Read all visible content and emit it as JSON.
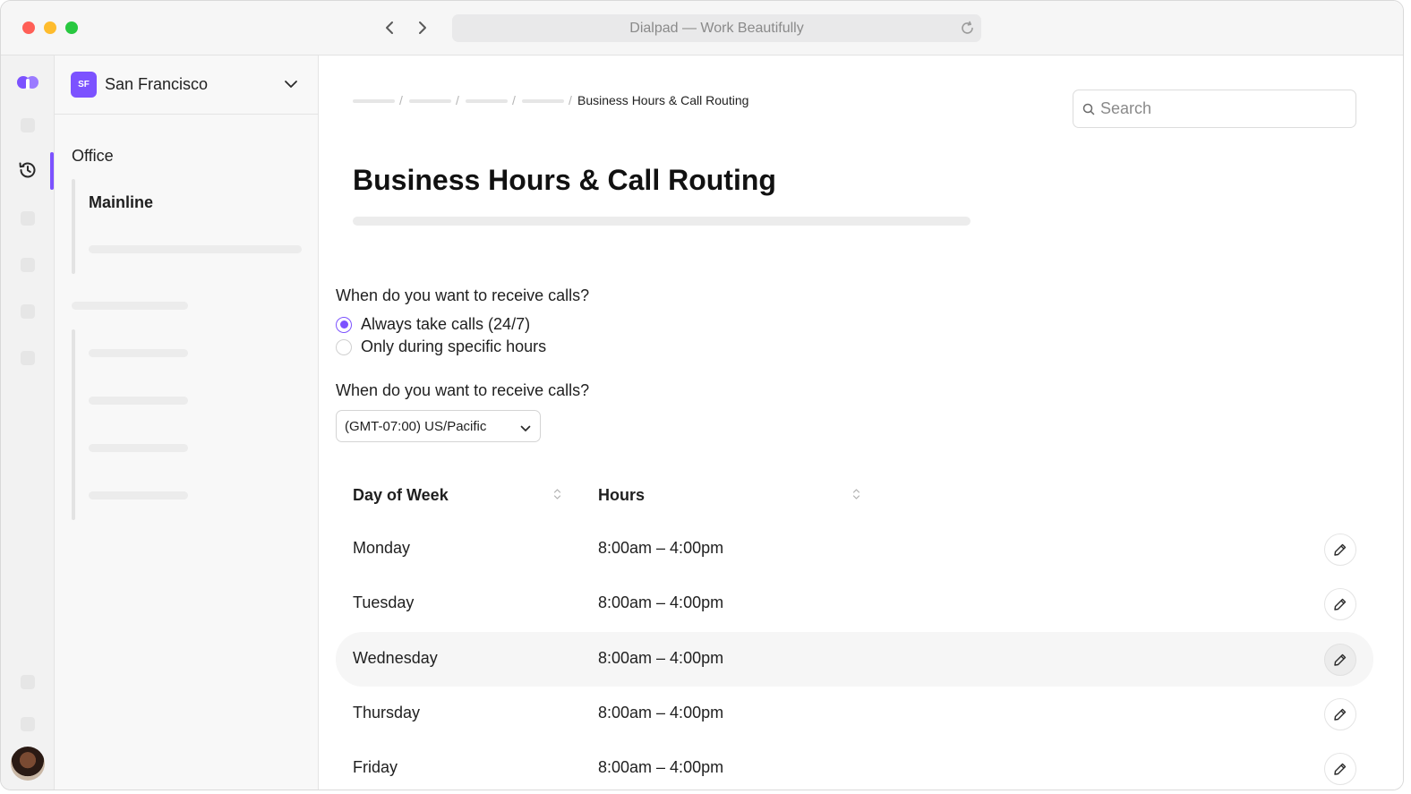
{
  "browser": {
    "url_title": "Dialpad — Work Beautifully"
  },
  "sidebar": {
    "org_badge": "SF",
    "org_name": "San Francisco",
    "section": "Office",
    "active_item": "Mainline"
  },
  "breadcrumb": {
    "current": "Business Hours & Call Routing",
    "separator": "/"
  },
  "search": {
    "placeholder": "Search"
  },
  "page": {
    "title": "Business Hours & Call Routing"
  },
  "calls_question": {
    "label": "When do you want to receive calls?",
    "options": [
      {
        "label": "Always take calls (24/7)",
        "checked": true
      },
      {
        "label": "Only during specific hours",
        "checked": false
      }
    ]
  },
  "timezone_question": {
    "label": "When do you want to receive calls?",
    "selected": "(GMT-07:00) US/Pacific"
  },
  "table": {
    "headers": [
      "Day of Week",
      "Hours"
    ],
    "rows": [
      {
        "day": "Monday",
        "hours": "8:00am – 4:00pm"
      },
      {
        "day": "Tuesday",
        "hours": "8:00am – 4:00pm"
      },
      {
        "day": "Wednesday",
        "hours": "8:00am – 4:00pm"
      },
      {
        "day": "Thursday",
        "hours": "8:00am – 4:00pm"
      },
      {
        "day": "Friday",
        "hours": "8:00am – 4:00pm"
      }
    ]
  },
  "colors": {
    "accent": "#7c52ff",
    "traffic_red": "#ff5f57",
    "traffic_yellow": "#febc2e",
    "traffic_green": "#28c840"
  },
  "icons": {
    "back": "chevron-left-icon",
    "forward": "chevron-right-icon",
    "reload": "reload-icon",
    "logo": "dialpad-logo",
    "history": "history-icon",
    "dropdown": "chevron-down-icon",
    "search": "search-icon",
    "sort": "sort-icon",
    "edit": "pencil-icon"
  }
}
